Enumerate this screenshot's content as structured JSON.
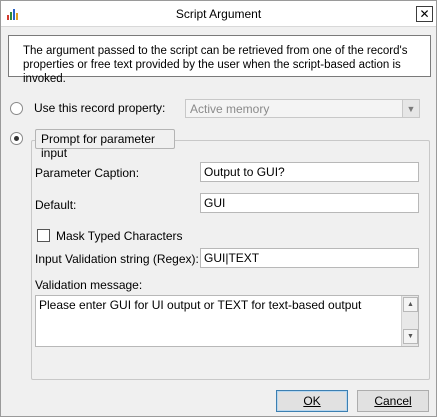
{
  "window": {
    "title": "Script Argument",
    "close_glyph": "✕",
    "icon": "bar-chart-icon"
  },
  "info_text": "The argument passed to the script can be retrieved from one of the record's properties or free text provided by the user when the script-based action is invoked.",
  "record_property": {
    "label": "Use this record property:",
    "selected": false,
    "combo_value": "Active memory",
    "arrow_glyph": "▼"
  },
  "prompt": {
    "label": "Prompt for parameter input",
    "selected": true,
    "caption_label": "Parameter Caption:",
    "caption_value": "Output to GUI?",
    "default_label": "Default:",
    "default_value": "GUI",
    "mask_label": "Mask Typed Characters",
    "mask_checked": false,
    "regex_label": "Input Validation string (Regex):",
    "regex_value": "GUI|TEXT",
    "validation_label": "Validation message:",
    "validation_value": "Please enter GUI for UI output or TEXT for text-based output",
    "scroll_up_glyph": "▲",
    "scroll_down_glyph": "▼"
  },
  "buttons": {
    "ok": "OK",
    "cancel": "Cancel"
  }
}
